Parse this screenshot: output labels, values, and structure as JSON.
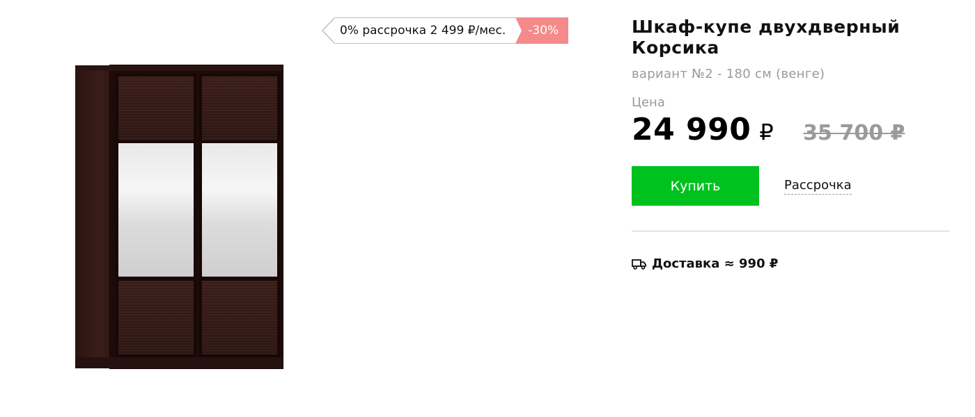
{
  "product": {
    "title": "Шкаф-купе двухдверный Корсика",
    "variant": "вариант №2 - 180 см (венге)",
    "image_icon": "wardrobe-image"
  },
  "promo": {
    "installment_text": "0% рассрочка 2 499 ₽/мес.",
    "discount": "-30%",
    "discount_color": "#f58a8a"
  },
  "price": {
    "label": "Цена",
    "current_value": "24 990",
    "currency": "₽",
    "old": "35 700 ₽"
  },
  "actions": {
    "buy_label": "Купить",
    "buy_color": "#00c21e",
    "installment_label": "Рассрочка"
  },
  "delivery": {
    "icon": "truck-icon",
    "text": "Доставка ≈ 990 ₽"
  }
}
